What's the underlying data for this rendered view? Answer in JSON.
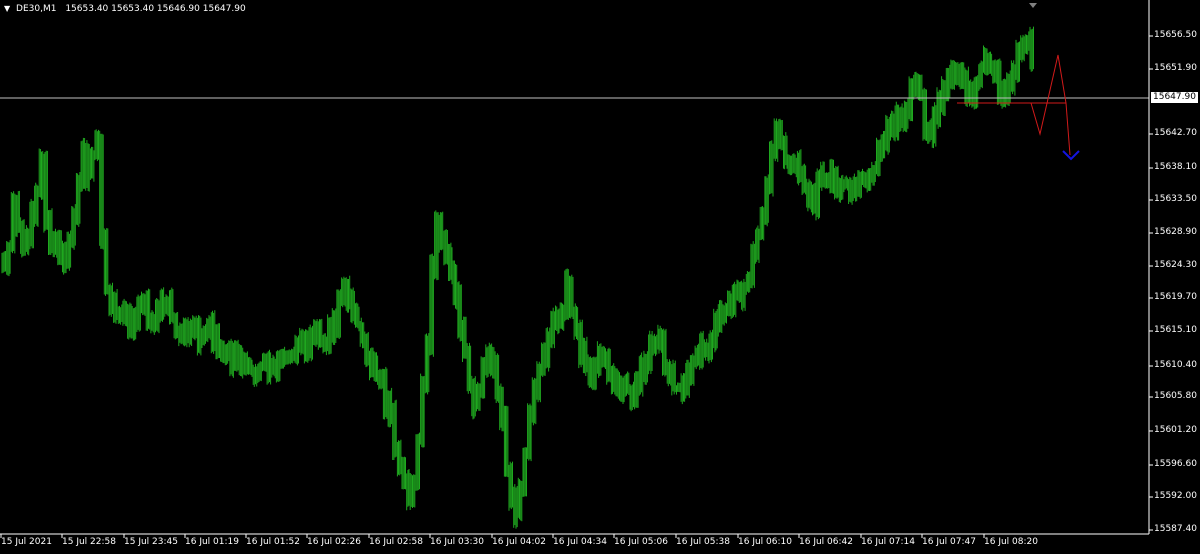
{
  "header": {
    "symbol": "DE30,M1",
    "ohlc": "15653.40 15653.40 15646.90 15647.90"
  },
  "current_price": "15647.90",
  "colors": {
    "background": "#000000",
    "axis": "#ffffff",
    "bars": "#1fa81f",
    "current_line": "#c0c0c0",
    "projection_red": "#d11a1a",
    "projection_blue": "#1414e0",
    "marker": "#808080"
  },
  "chart_data": {
    "type": "bar",
    "ylim": [
      15586.5,
      15659.5
    ],
    "y_ticks": [
      "15656.50",
      "15651.90",
      "15647.90",
      "15642.70",
      "15638.10",
      "15633.50",
      "15628.90",
      "15624.30",
      "15619.70",
      "15615.10",
      "15610.40",
      "15605.80",
      "15601.20",
      "15596.60",
      "15592.00",
      "15587.40"
    ],
    "x_ticks": [
      "15 Jul 2021",
      "15 Jul 22:58",
      "15 Jul 23:45",
      "16 Jul 01:19",
      "16 Jul 01:52",
      "16 Jul 02:26",
      "16 Jul 02:58",
      "16 Jul 03:30",
      "16 Jul 04:02",
      "16 Jul 04:34",
      "16 Jul 05:06",
      "16 Jul 05:38",
      "16 Jul 06:10",
      "16 Jul 06:42",
      "16 Jul 07:14",
      "16 Jul 07:47",
      "16 Jul 08:20"
    ],
    "series": [
      {
        "values": [
          15625,
          15627,
          15633,
          15630,
          15627,
          15628,
          15632,
          15635,
          15639,
          15630,
          15627,
          15628,
          15626,
          15625,
          15628,
          15632,
          15636,
          15640,
          15637,
          15640,
          15642,
          15628,
          15621,
          15619,
          15618,
          15617,
          15618,
          15616,
          15617,
          15618,
          15619,
          15617,
          15616,
          15618,
          15619,
          15619,
          15617,
          15615,
          15614,
          15615,
          15616,
          15615,
          15614,
          15615,
          15616,
          15614,
          15613,
          15612,
          15612,
          15611,
          15612,
          15611,
          15610,
          15610,
          15609,
          15610,
          15611,
          15610,
          15610,
          15611,
          15612,
          15612,
          15612,
          15613,
          15614,
          15613,
          15614,
          15615,
          15614,
          15614,
          15615,
          15616,
          15620,
          15622,
          15620,
          15618,
          15616,
          15614,
          15612,
          15610,
          15609,
          15608,
          15605,
          15603,
          15598,
          15596,
          15594,
          15592,
          15594,
          15600,
          15608,
          15614,
          15624,
          15630,
          15628,
          15626,
          15624,
          15620,
          15615,
          15612,
          15608,
          15605,
          15607,
          15610,
          15612,
          15610,
          15606,
          15603,
          15596,
          15592,
          15590,
          15593,
          15598,
          15603,
          15607,
          15610,
          15612,
          15614,
          15616,
          15617,
          15618,
          15622,
          15618,
          15615,
          15612,
          15610,
          15609,
          15611,
          15612,
          15611,
          15610,
          15608,
          15607,
          15608,
          15607,
          15606,
          15608,
          15610,
          15611,
          15613,
          15614,
          15613,
          15610,
          15609,
          15607,
          15607,
          15608,
          15609,
          15611,
          15612,
          15613,
          15612,
          15614,
          15616,
          15617,
          15618,
          15619,
          15620,
          15620,
          15621,
          15622,
          15626,
          15629,
          15632,
          15636,
          15640,
          15643,
          15642,
          15639,
          15638,
          15639,
          15637,
          15635,
          15634,
          15633,
          15636,
          15637,
          15637,
          15636,
          15635,
          15636,
          15636,
          15635,
          15636,
          15637,
          15636,
          15637,
          15638,
          15640,
          15642,
          15643,
          15644,
          15645,
          15644,
          15646,
          15649,
          15650,
          15648,
          15644,
          15643,
          15645,
          15647,
          15649,
          15651,
          15652,
          15651,
          15650,
          15649,
          15648,
          15650,
          15652,
          15653,
          15652,
          15651,
          15649,
          15648,
          15650,
          15652,
          15654,
          15655,
          15656,
          15654
        ]
      }
    ],
    "projection": {
      "red": [
        [
          15647.9,
          15642.0,
          15654.0,
          15647.9,
          15639.0
        ],
        [
          15647.9,
          15647.9
        ]
      ],
      "blue_target": 15639.0
    }
  }
}
